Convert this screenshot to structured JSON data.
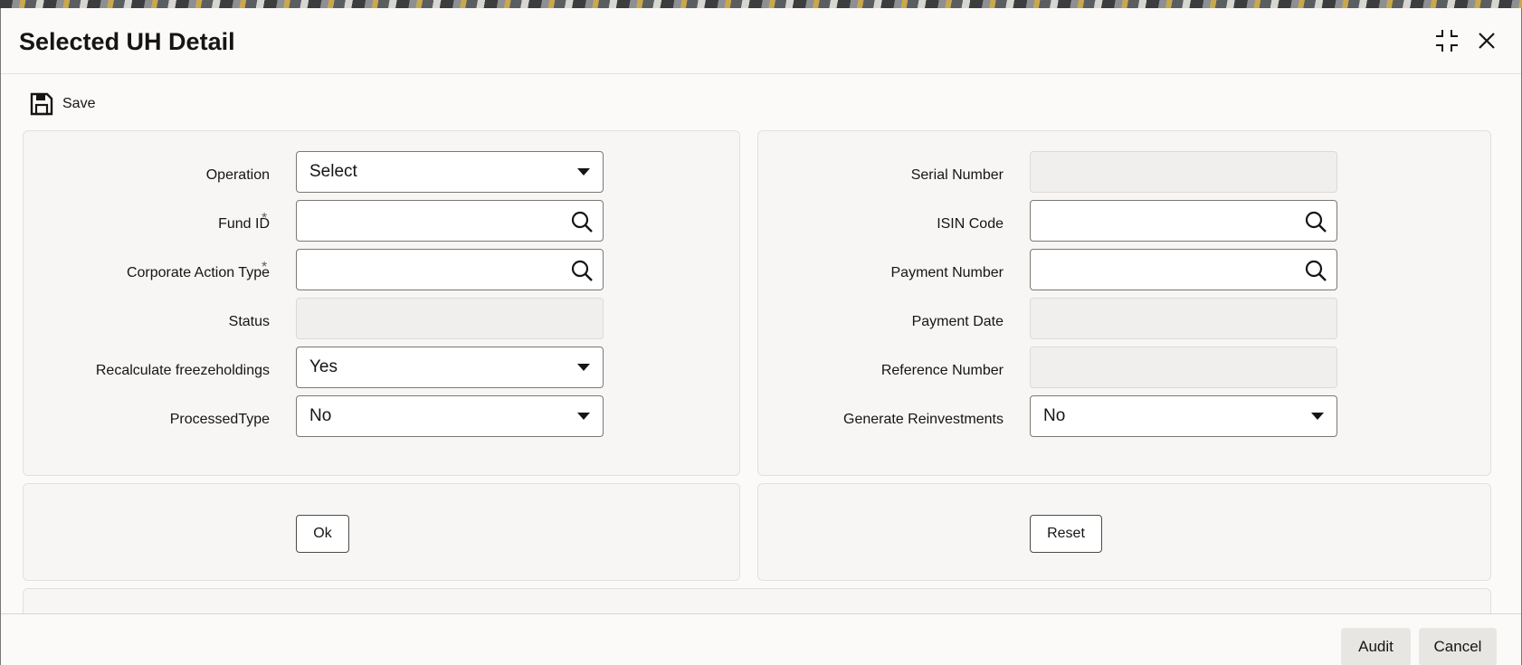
{
  "window": {
    "title": "Selected UH Detail"
  },
  "toolbar": {
    "save_label": "Save"
  },
  "left_panel": {
    "operation": {
      "label": "Operation",
      "value": "Select"
    },
    "fund_id": {
      "label": "Fund ID",
      "required_mark": "*",
      "value": ""
    },
    "corporate_action_type": {
      "label": "Corporate Action Type",
      "required_mark": "*",
      "value": ""
    },
    "status": {
      "label": "Status",
      "value": ""
    },
    "recalculate_freezeholdings": {
      "label": "Recalculate freezeholdings",
      "value": "Yes"
    },
    "processed_type": {
      "label": "ProcessedType",
      "value": "No"
    }
  },
  "right_panel": {
    "serial_number": {
      "label": "Serial Number",
      "value": ""
    },
    "isin_code": {
      "label": "ISIN Code",
      "value": ""
    },
    "payment_number": {
      "label": "Payment Number",
      "value": ""
    },
    "payment_date": {
      "label": "Payment Date",
      "value": ""
    },
    "reference_number": {
      "label": "Reference Number",
      "value": ""
    },
    "generate_reinvestments": {
      "label": "Generate Reinvestments",
      "value": "No"
    }
  },
  "actions": {
    "ok_label": "Ok",
    "reset_label": "Reset"
  },
  "footer": {
    "audit_label": "Audit",
    "cancel_label": "Cancel"
  },
  "icons": {
    "save": "floppy-disk-icon",
    "maximize": "restore-window-icon",
    "close": "close-icon",
    "search": "search-icon",
    "dropdown": "caret-down-icon"
  },
  "colors": {
    "border": "#7b7874",
    "panel": "#f7f6f4",
    "readonly": "#f1efed"
  }
}
